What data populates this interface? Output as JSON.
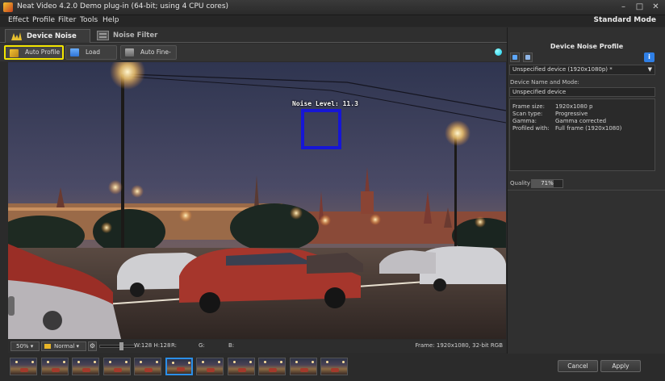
{
  "window": {
    "title": "Neat Video 4.2.0 Demo plug-in (64-bit; using 4 CPU cores)",
    "controls": [
      "–",
      "□",
      "✕"
    ]
  },
  "menu": {
    "items": [
      "Effect",
      "Profile",
      "Filter",
      "Tools",
      "Help"
    ],
    "mode": "Standard Mode"
  },
  "tabs": [
    {
      "label": "Device Noise Profile",
      "active": true,
      "icon": "device-profile-icon"
    },
    {
      "label": "Noise Filter Settings",
      "active": false,
      "icon": "filter-settings-icon"
    }
  ],
  "toolbar": {
    "auto_profile": "Auto Profile",
    "load_profile": "Load Profile",
    "auto_fine_tune": "Auto Fine-Tune"
  },
  "viewer": {
    "noise_label": "Noise Level: 11.3"
  },
  "statusbar": {
    "zoom": "50%",
    "mode": "Normal",
    "size": "W:128 H:128",
    "r": "R:",
    "g": "G:",
    "b": "B:",
    "frame": "Frame: 1920x1080, 32-bit RGB"
  },
  "thumbnails": {
    "count": 11,
    "selected_index": 5
  },
  "dialog": {
    "cancel": "Cancel",
    "apply": "Apply"
  },
  "side_panel": {
    "title": "Device Noise Profile",
    "device_select": "Unspecified device (1920x1080p) *",
    "name_mode_label": "Device Name and Mode:",
    "name_value": "Unspecified device",
    "info": [
      {
        "key": "Frame size:",
        "value": "1920x1080 p"
      },
      {
        "key": "Scan type:",
        "value": "Progressive"
      },
      {
        "key": "Gamma:",
        "value": "Gamma corrected"
      },
      {
        "key": "Profiled with:",
        "value": "Full frame (1920x1080)"
      }
    ],
    "quality_label": "Quality",
    "quality_value": "71%",
    "quality_fraction": 0.71
  },
  "colors": {
    "highlight": "#f3e500",
    "noise_box": "#1616d6",
    "selected_thumb": "#2b8fe8",
    "indicator": "#16c8e8"
  }
}
